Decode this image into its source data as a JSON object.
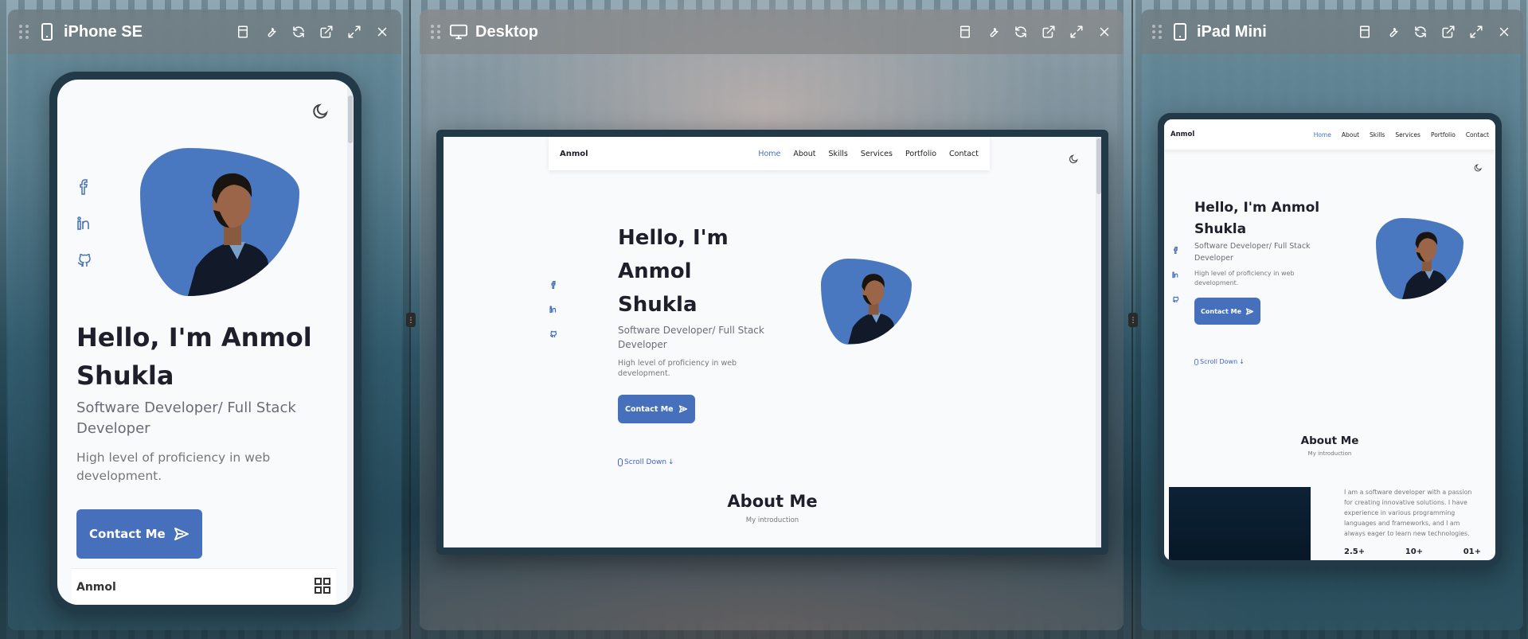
{
  "panels": {
    "iphone": {
      "title": "iPhone SE"
    },
    "desktop": {
      "title": "Desktop"
    },
    "ipad": {
      "title": "iPad Mini"
    }
  },
  "site": {
    "brand": "Anmol",
    "nav": [
      "Home",
      "About",
      "Skills",
      "Services",
      "Portfolio",
      "Contact"
    ],
    "hero": {
      "title_line1": "Hello, I'm",
      "title_line2": "Anmol Shukla",
      "title_full_line1": "Hello, I'm Anmol",
      "title_full_line2": "Shukla",
      "subtitle": "Software Developer/ Full Stack Developer",
      "description": "High level of proficiency in web development.",
      "cta": "Contact Me",
      "scroll": "Scroll Down"
    },
    "about": {
      "title": "About Me",
      "subtitle": "My introduction",
      "text": "I am a software developer with a passion for creating innovative solutions. I have experience in various programming languages and frameworks, and I am always eager to learn new technologies.",
      "stats": [
        "2.5+",
        "10+",
        "01+"
      ]
    }
  },
  "colors": {
    "accent": "#4670bb",
    "frame": "#223a47",
    "header": "#7a7a7a"
  }
}
